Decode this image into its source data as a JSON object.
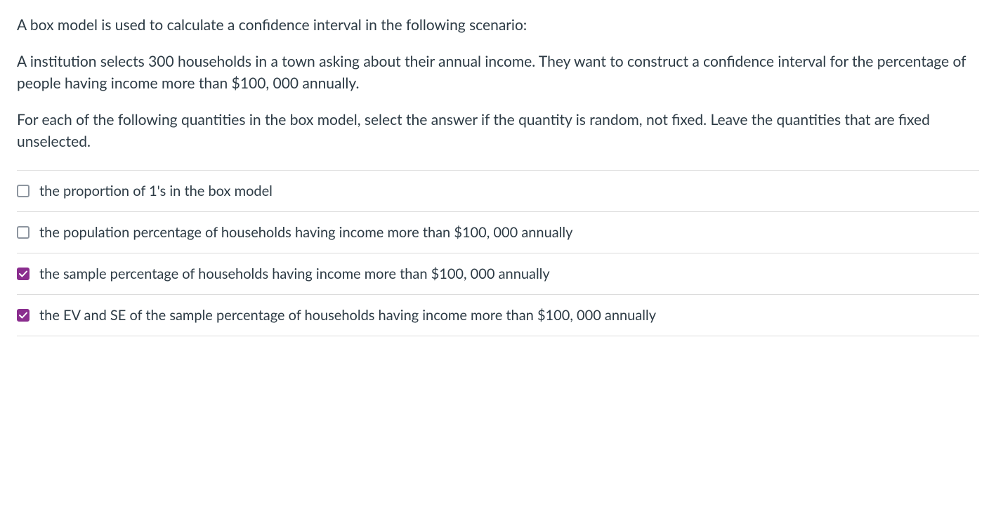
{
  "question": {
    "paragraph1": "A box model is used to calculate a confidence interval in the following scenario:",
    "paragraph2": "A institution selects 300 households in a town asking about their annual income. They want to construct a confidence interval for the percentage of people having income more than $100, 000 annually.",
    "paragraph3": "For each of the following quantities in the box model, select the answer if the quantity is random, not fixed. Leave the quantities that are fixed unselected."
  },
  "options": [
    {
      "label": "the proportion of 1's in the box model",
      "checked": false
    },
    {
      "label": "the population percentage of households having income more than $100, 000 annually",
      "checked": false
    },
    {
      "label": "the sample percentage of households having income more than $100, 000 annually",
      "checked": true
    },
    {
      "label": "the EV and SE of the sample percentage of households having income more than $100, 000 annually",
      "checked": true
    }
  ]
}
